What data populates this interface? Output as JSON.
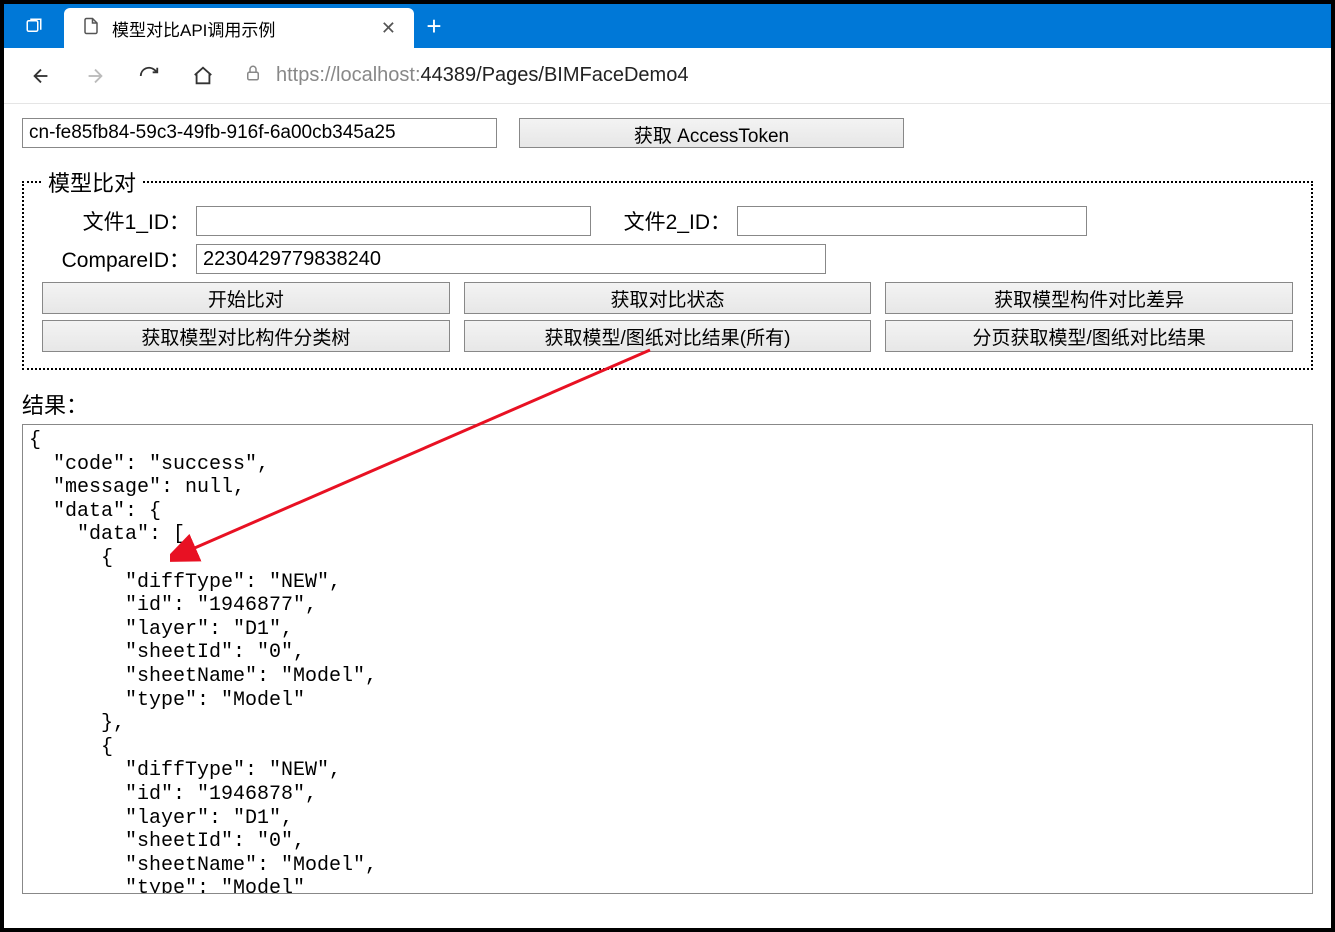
{
  "browser": {
    "tab_title": "模型对比API调用示例",
    "url_host": "https://localhost:",
    "url_port_path": "44389/Pages/BIMFaceDemo4"
  },
  "top": {
    "token_value": "cn-fe85fb84-59c3-49fb-916f-6a00cb345a25",
    "get_token_btn": "获取 AccessToken"
  },
  "compare": {
    "legend": "模型比对",
    "file1_label": "文件1_ID：",
    "file1_value": "",
    "file2_label": "文件2_ID：",
    "file2_value": "",
    "compareid_label": "CompareID：",
    "compareid_value": "2230429779838240",
    "buttons": {
      "b1": "开始比对",
      "b2": "获取对比状态",
      "b3": "获取模型构件对比差异",
      "b4": "获取模型对比构件分类树",
      "b5": "获取模型/图纸对比结果(所有)",
      "b6": "分页获取模型/图纸对比结果"
    }
  },
  "result": {
    "label": "结果：",
    "body": "{\n  ″code″: ″success″,\n  ″message″: null,\n  ″data″: {\n    ″data″: [\n      {\n        ″diffType″: ″NEW″,\n        ″id″: ″1946877″,\n        ″layer″: ″D1″,\n        ″sheetId″: ″0″,\n        ″sheetName″: ″Model″,\n        ″type″: ″Model″\n      },\n      {\n        ″diffType″: ″NEW″,\n        ″id″: ″1946878″,\n        ″layer″: ″D1″,\n        ″sheetId″: ″0″,\n        ″sheetName″: ″Model″,\n        ″type″: ″Model″"
  }
}
